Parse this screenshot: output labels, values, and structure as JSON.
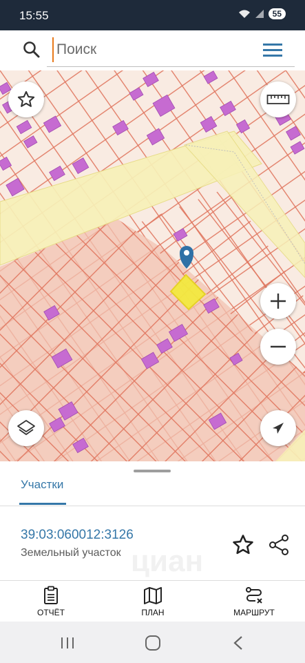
{
  "status_bar": {
    "time": "15:55",
    "battery": "55"
  },
  "search": {
    "placeholder": "Поиск"
  },
  "bottom_sheet": {
    "tab_label": "Участки",
    "parcel_number": "39:03:060012:3126",
    "parcel_type": "Земельный участок",
    "watermark": "циан"
  },
  "bottom_nav": {
    "report_label": "ОТЧЁТ",
    "plan_label": "ПЛАН",
    "route_label": "МАРШРУТ"
  },
  "colors": {
    "accent": "#3577a8",
    "parcel_outline": "#e0765f",
    "building": "#c66bd1",
    "highlight": "#f3e940",
    "road": "#f7f1b8",
    "zone": "#f2c3b2"
  },
  "icons": [
    "search-icon",
    "menu-icon",
    "star-icon",
    "ruler-icon",
    "zoom-in-icon",
    "zoom-out-icon",
    "layers-icon",
    "location-arrow-icon",
    "map-pin-icon",
    "share-icon",
    "report-icon",
    "plan-icon",
    "route-icon"
  ]
}
